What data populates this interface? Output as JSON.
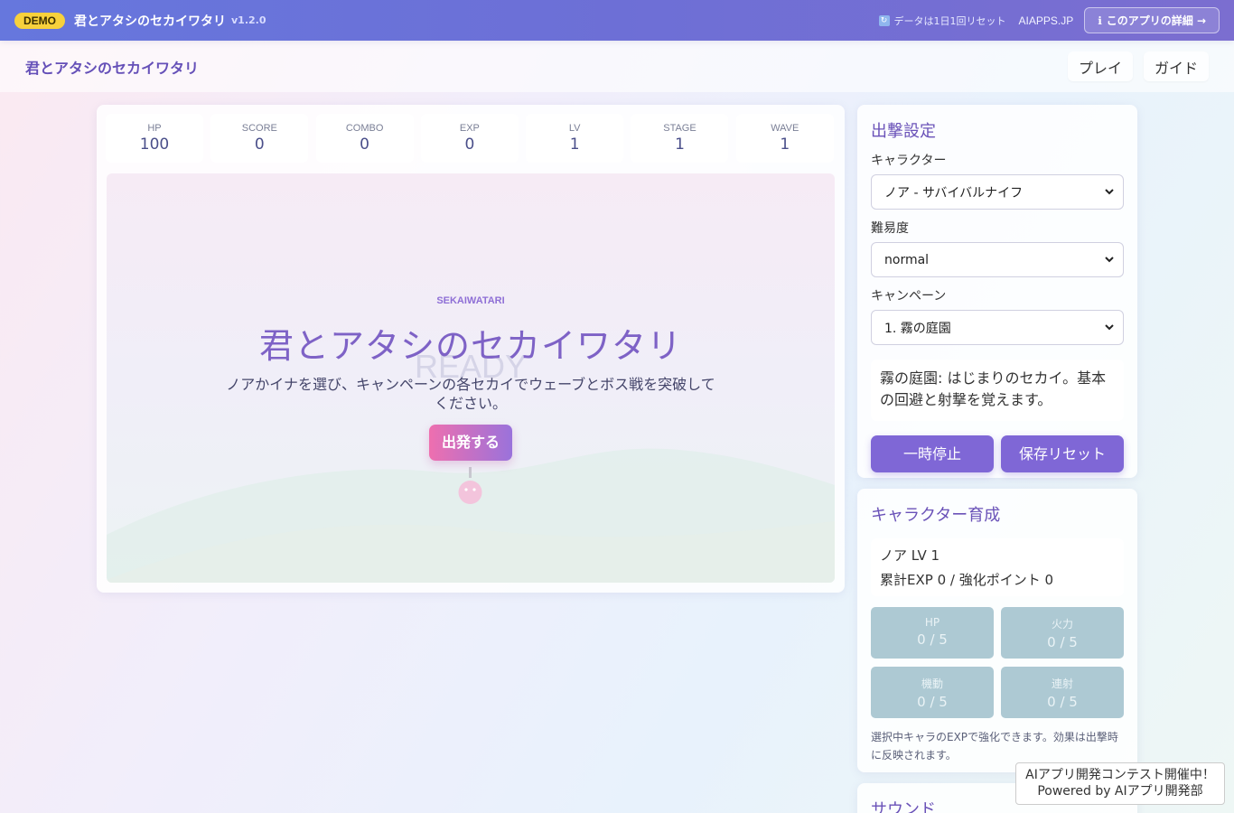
{
  "topbar": {
    "badge": "DEMO",
    "title": "君とアタシのセカイワタリ",
    "version": "v1.2.0",
    "reset_note": "データは1日1回リセット",
    "site": "AIAPPS.JP",
    "detail_button": "このアプリの詳細 →"
  },
  "header": {
    "title": "君とアタシのセカイワタリ",
    "nav": [
      "プレイ",
      "ガイド"
    ]
  },
  "stats": [
    {
      "label": "HP",
      "value": "100"
    },
    {
      "label": "SCORE",
      "value": "0"
    },
    {
      "label": "COMBO",
      "value": "0"
    },
    {
      "label": "EXP",
      "value": "0"
    },
    {
      "label": "LV",
      "value": "1"
    },
    {
      "label": "STAGE",
      "value": "1"
    },
    {
      "label": "WAVE",
      "value": "1"
    }
  ],
  "game": {
    "subtitle": "SEKAIWATARI",
    "ready": "READY",
    "title": "君とアタシのセカイワタリ",
    "description": "ノアかイナを選び、キャンペーンの各セカイでウェーブとボス戦を突破してください。",
    "start_button": "出発する"
  },
  "settings": {
    "title": "出撃設定",
    "character_label": "キャラクター",
    "character_value": "ノア - サバイバルナイフ",
    "difficulty_label": "難易度",
    "difficulty_value": "normal",
    "campaign_label": "キャンペーン",
    "campaign_value": "1. 霧の庭園",
    "campaign_info": "霧の庭園: はじまりのセカイ。基本の回避と射撃を覚えます。",
    "pause_button": "一時停止",
    "reset_button": "保存リセット"
  },
  "training": {
    "title": "キャラクター育成",
    "char_level": "ノア LV 1",
    "exp_points": "累計EXP 0 / 強化ポイント 0",
    "upgrades": [
      {
        "label": "HP",
        "value": "0 / 5"
      },
      {
        "label": "火力",
        "value": "0 / 5"
      },
      {
        "label": "機動",
        "value": "0 / 5"
      },
      {
        "label": "連射",
        "value": "0 / 5"
      }
    ],
    "note": "選択中キャラのEXPで強化できます。効果は出撃時に反映されます。"
  },
  "sound": {
    "title": "サウンド"
  },
  "contest": {
    "line1": "AIアプリ開発コンテスト開催中！",
    "line2": "Powered by AIアプリ開発部"
  }
}
